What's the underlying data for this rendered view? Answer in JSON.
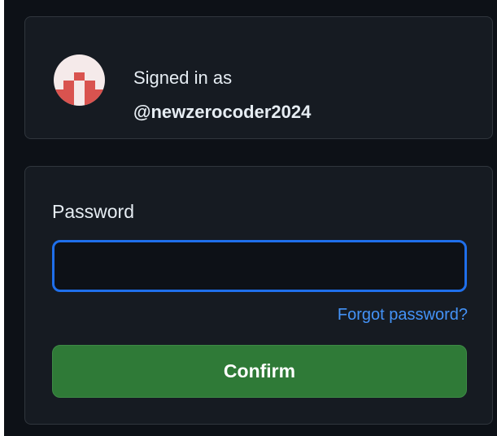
{
  "account": {
    "signed_in_label": "Signed in as",
    "username": "@newzerocoder2024",
    "avatar": {
      "icon": "identicon-avatar",
      "background": "#f5eaea",
      "pattern_color": "#d9534f"
    }
  },
  "form": {
    "password_label": "Password",
    "password_value": "",
    "forgot_password_link": "Forgot password?",
    "confirm_button": "Confirm"
  },
  "colors": {
    "page_background": "#0d1117",
    "card_background": "#161b22",
    "card_border": "#30363d",
    "input_focus_border": "#1f6feb",
    "link": "#4493f8",
    "button_primary": "#2f7a37",
    "text_primary": "#e6edf3"
  }
}
